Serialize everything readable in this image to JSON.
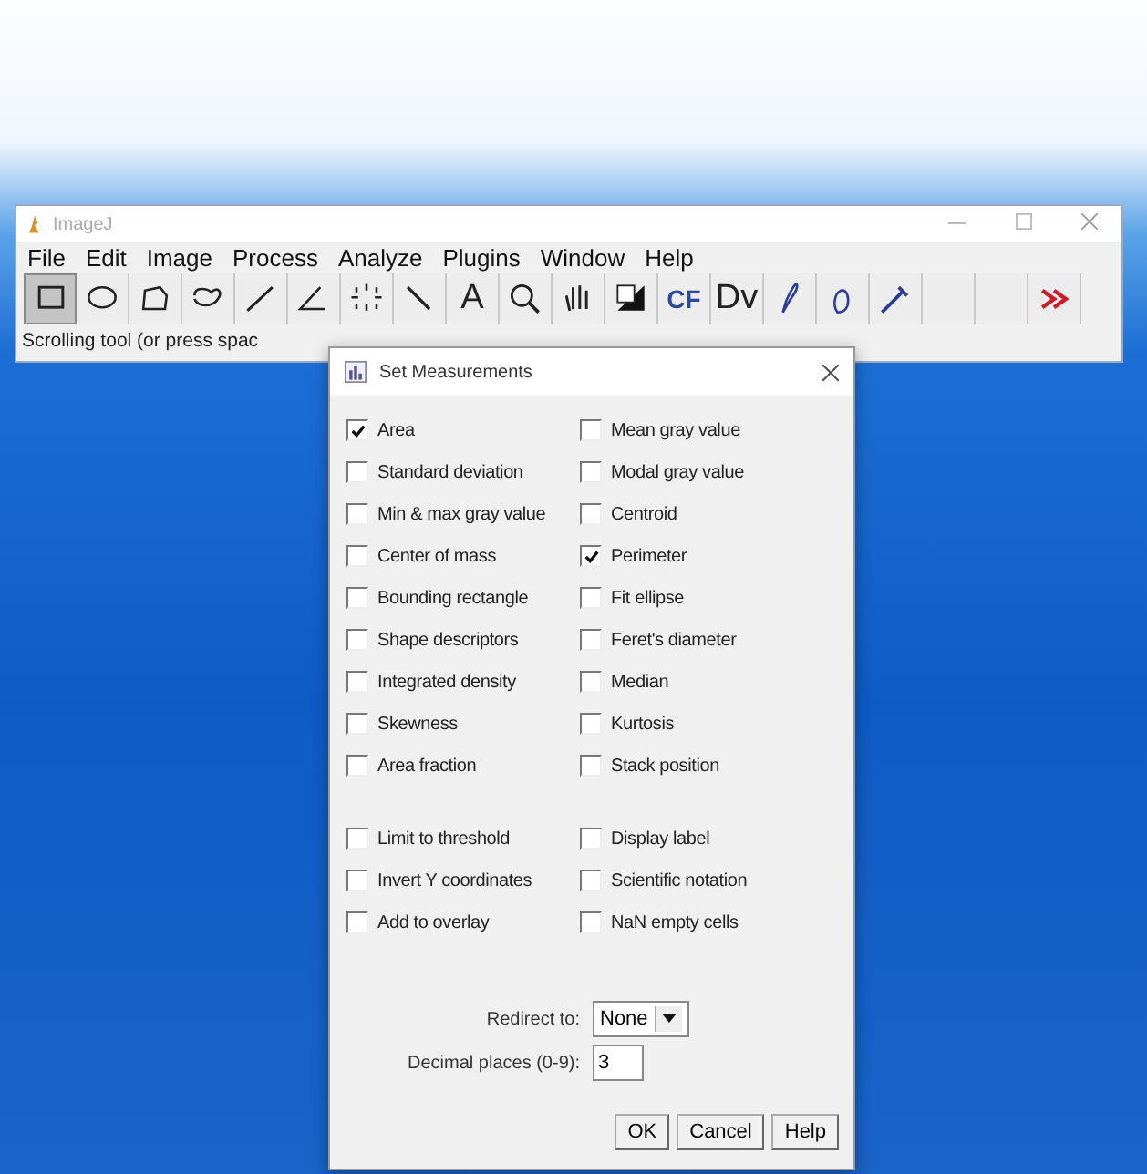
{
  "window": {
    "title": "ImageJ",
    "menu": [
      "File",
      "Edit",
      "Image",
      "Process",
      "Analyze",
      "Plugins",
      "Window",
      "Help"
    ],
    "tools": [
      {
        "selected": true
      },
      {
        "selected": false
      },
      {
        "selected": false
      },
      {
        "selected": false
      },
      {
        "selected": false
      },
      {
        "selected": false
      },
      {
        "selected": false
      },
      {
        "selected": false
      },
      {
        "label": "A",
        "selected": false
      },
      {
        "selected": false
      },
      {
        "selected": false
      },
      {
        "selected": false
      },
      {
        "label": "CF",
        "selected": false
      },
      {
        "label": "Dv",
        "selected": false
      },
      {
        "selected": false
      },
      {
        "selected": false
      },
      {
        "selected": false
      },
      {
        "selected": false
      },
      {
        "selected": false
      },
      {
        "selected": false
      }
    ],
    "status_bar": "Scrolling tool (or press spac"
  },
  "dialog": {
    "title": "Set Measurements",
    "measurements": [
      {
        "label": "Area",
        "checked": true
      },
      {
        "label": "Mean gray value",
        "checked": false
      },
      {
        "label": "Standard deviation",
        "checked": false
      },
      {
        "label": "Modal gray value",
        "checked": false
      },
      {
        "label": "Min & max gray value",
        "checked": false
      },
      {
        "label": "Centroid",
        "checked": false
      },
      {
        "label": "Center of mass",
        "checked": false
      },
      {
        "label": "Perimeter",
        "checked": true
      },
      {
        "label": "Bounding rectangle",
        "checked": false
      },
      {
        "label": "Fit ellipse",
        "checked": false
      },
      {
        "label": "Shape descriptors",
        "checked": false
      },
      {
        "label": "Feret's diameter",
        "checked": false
      },
      {
        "label": "Integrated density",
        "checked": false
      },
      {
        "label": "Median",
        "checked": false
      },
      {
        "label": "Skewness",
        "checked": false
      },
      {
        "label": "Kurtosis",
        "checked": false
      },
      {
        "label": "Area fraction",
        "checked": false
      },
      {
        "label": "Stack position",
        "checked": false
      }
    ],
    "options": [
      {
        "label": "Limit to threshold",
        "checked": false
      },
      {
        "label": "Display label",
        "checked": false
      },
      {
        "label": "Invert Y coordinates",
        "checked": false
      },
      {
        "label": "Scientific notation",
        "checked": false
      },
      {
        "label": "Add to overlay",
        "checked": false
      },
      {
        "label": "NaN empty cells",
        "checked": false
      }
    ],
    "redirect": {
      "label": "Redirect to:",
      "value": "None"
    },
    "decimal": {
      "label": "Decimal places (0-9):",
      "value": "3"
    },
    "buttons": [
      "OK",
      "Cancel",
      "Help"
    ]
  }
}
